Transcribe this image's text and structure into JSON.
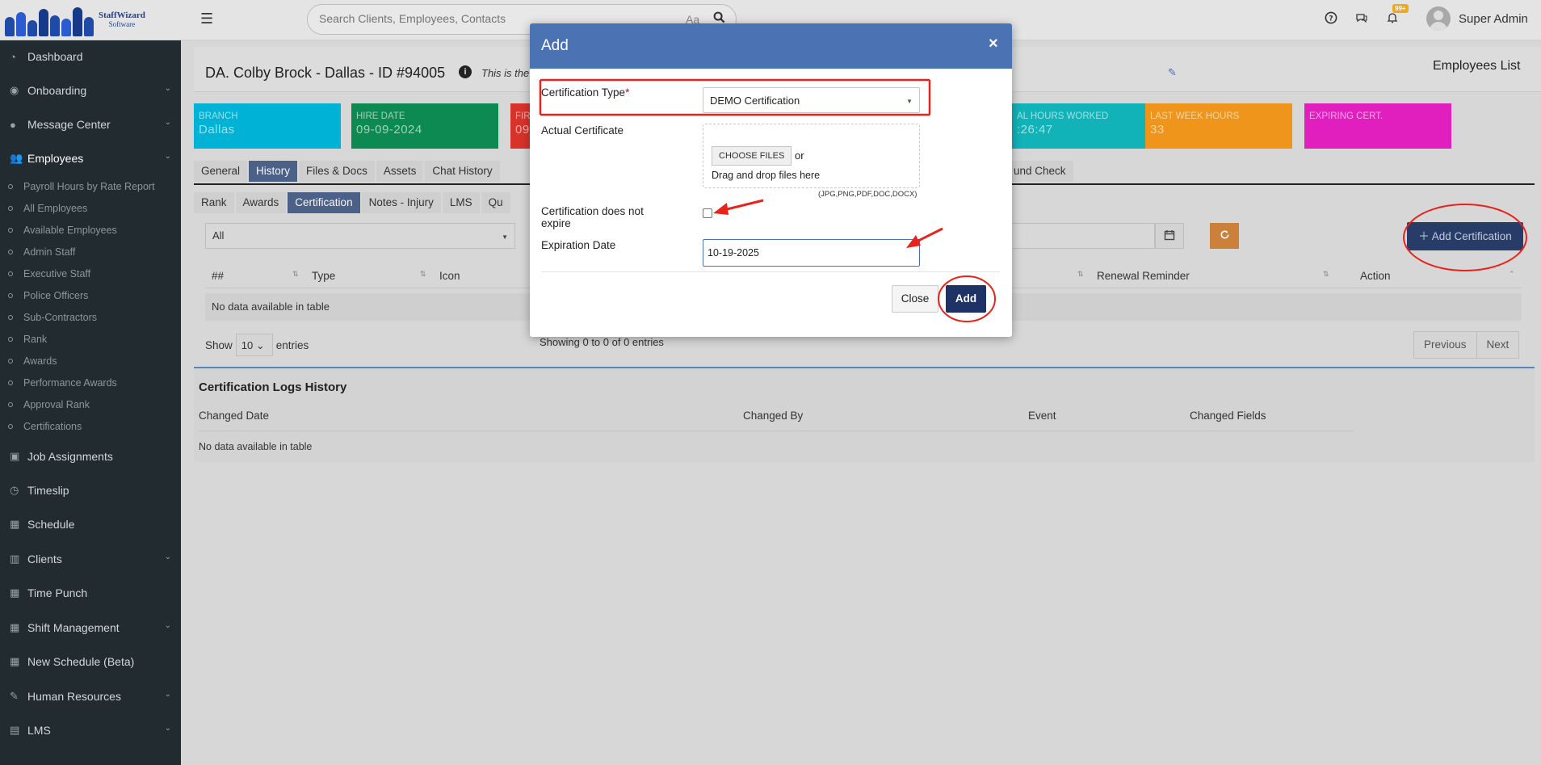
{
  "header": {
    "logo_line1": "StaffWizard",
    "logo_line2": "Software",
    "search_placeholder": "Search Clients, Employees, Contacts",
    "search_case_label": "Aa",
    "notification_count": "99+",
    "user_name": "Super Admin"
  },
  "sidebar": {
    "items": [
      {
        "label": "Dashboard",
        "icon": "dashboard-icon"
      },
      {
        "label": "Onboarding",
        "icon": "eye-icon"
      },
      {
        "label": "Message Center",
        "icon": "chat-icon"
      },
      {
        "label": "Employees",
        "icon": "users-icon"
      },
      {
        "label": "Job Assignments",
        "icon": "briefcase-icon"
      },
      {
        "label": "Timeslip",
        "icon": "clock-icon"
      },
      {
        "label": "Schedule",
        "icon": "calendar-icon"
      },
      {
        "label": "Clients",
        "icon": "building-icon"
      },
      {
        "label": "Time Punch",
        "icon": "calendar-icon"
      },
      {
        "label": "Shift Management",
        "icon": "calendar-icon"
      },
      {
        "label": "New Schedule (Beta)",
        "icon": "calendar-icon"
      },
      {
        "label": "Human Resources",
        "icon": "pencil-icon"
      },
      {
        "label": "LMS",
        "icon": "book-icon"
      }
    ],
    "employee_subitems": [
      "Payroll Hours by Rate Report",
      "All Employees",
      "Available Employees",
      "Admin Staff",
      "Executive Staff",
      "Police Officers",
      "Sub-Contractors",
      "Rank",
      "Awards",
      "Performance Awards",
      "Approval Rank",
      "Certifications"
    ]
  },
  "page": {
    "title": "DA. Colby Brock - Dallas - ID #94005",
    "subtitle": "This is the",
    "employees_list_link": "Employees List"
  },
  "cards": [
    {
      "label": "BRANCH",
      "value": "Dallas",
      "color": "#00b3d6"
    },
    {
      "label": "HIRE DATE",
      "value": "09-09-2024",
      "color": "#0c8a52"
    },
    {
      "label": "FIR",
      "value": "09",
      "color": "#d8332b"
    },
    {
      "label": "AL HOURS WORKED",
      "value": ":26:47",
      "color": "#11b3b8"
    },
    {
      "label": "LAST WEEK HOURS",
      "value": "33",
      "color": "#f0951c"
    },
    {
      "label": "EXPIRING CERT.",
      "value": "",
      "color": "#e11fbf"
    }
  ],
  "tabs": [
    "General",
    "History",
    "Files & Docs",
    "Assets",
    "Chat History",
    "und Check"
  ],
  "subtabs": [
    "Rank",
    "Awards",
    "Certification",
    "Notes - Injury",
    "LMS",
    "Qu"
  ],
  "filter": {
    "value": "All"
  },
  "add_certification_label": "Add Certification",
  "table": {
    "headers": [
      "##",
      "Type",
      "Icon",
      "Renewal Reminder",
      "Action"
    ],
    "empty_text": "No data available in table",
    "show_label": "Show",
    "page_size": "10",
    "entries_label": "entries",
    "showing_text": "Showing 0 to 0 of 0 entries",
    "previous_label": "Previous",
    "next_label": "Next"
  },
  "logs": {
    "title": "Certification Logs History",
    "headers": [
      "Changed Date",
      "Changed By",
      "Event",
      "Changed Fields"
    ],
    "empty_text": "No data available in table"
  },
  "modal": {
    "title": "Add",
    "close_symbol": "×",
    "certification_type_label": "Certification Type",
    "required_mark": "*",
    "certification_type_value": "DEMO Certification",
    "actual_certificate_label": "Actual Certificate",
    "choose_files_label": "CHOOSE FILES",
    "or_label": "or",
    "drag_label": "Drag and drop files here",
    "file_types_hint": "(JPG,PNG,PDF,DOC,DOCX)",
    "does_not_expire_label_1": "Certification does not",
    "does_not_expire_label_2": "expire",
    "expiration_date_label": "Expiration Date",
    "expiration_date_value": "10-19-2025",
    "close_button": "Close",
    "add_button": "Add"
  },
  "colors": {
    "sidebar_bg": "#212b30",
    "modal_header": "#4b73b4",
    "primary_button": "#1e3266",
    "annotation_red": "#e8231c"
  }
}
